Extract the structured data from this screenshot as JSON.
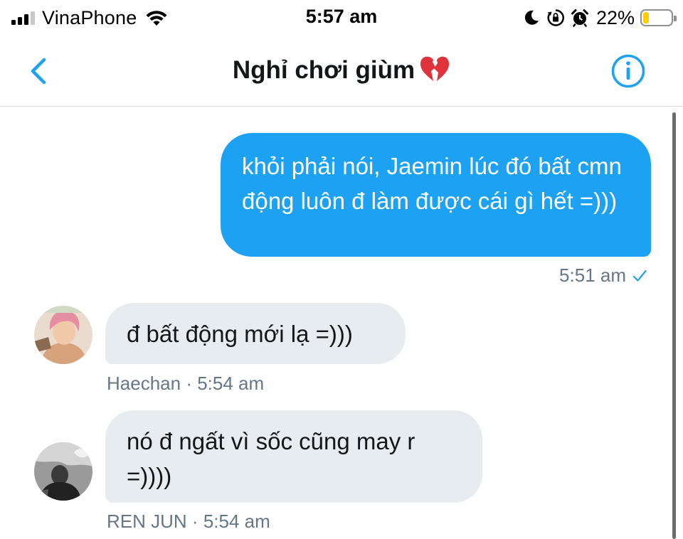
{
  "status_bar": {
    "carrier": "VinaPhone",
    "time": "5:57 am",
    "battery_percent": "22%",
    "battery_level": 0.22,
    "icons": [
      "signal-icon",
      "wifi-icon",
      "moon-icon",
      "orientation-lock-icon",
      "alarm-icon",
      "battery-icon"
    ]
  },
  "header": {
    "title": "Nghỉ chơi giùm",
    "title_emoji": "broken-heart-icon",
    "back_icon": "chevron-left-icon",
    "info_icon": "info-icon"
  },
  "colors": {
    "accent": "#1da1f2",
    "incoming_bubble": "#e6ecf0",
    "meta_text": "#657786"
  },
  "messages": [
    {
      "direction": "outgoing",
      "text": "khỏi phải nói, Jaemin lúc đó bất cmn động luôn đ làm được cái gì hết =)))",
      "time": "5:51 am",
      "status_icon": "check-icon"
    },
    {
      "direction": "incoming",
      "text": "đ bất động mới lạ =)))",
      "sender": "Haechan",
      "separator": "·",
      "time": "5:54 am"
    },
    {
      "direction": "incoming",
      "text": "nó đ ngất vì sốc cũng may r =))))",
      "sender": "REN JUN",
      "separator": "·",
      "time": "5:54 am"
    }
  ]
}
